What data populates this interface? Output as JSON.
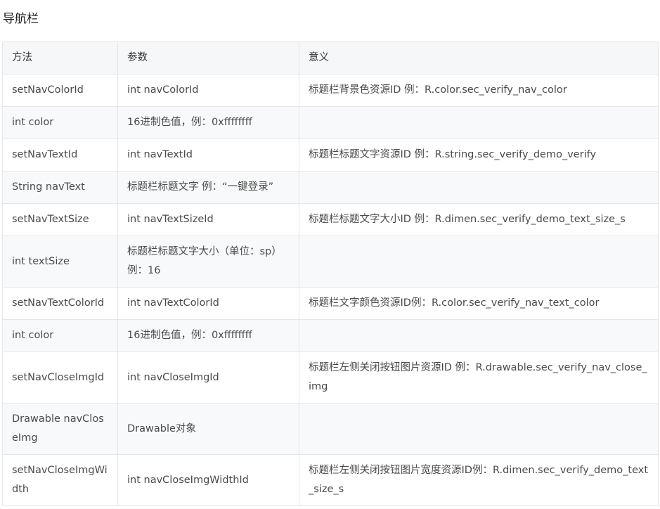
{
  "section": {
    "title": "导航栏"
  },
  "table": {
    "headers": [
      "方法",
      "参数",
      "意义"
    ],
    "rows": [
      {
        "method": "setNavColorId",
        "param": "int navColorId",
        "meaning": "标题栏背景色资源ID 例：R.color.sec_verify_nav_color"
      },
      {
        "method": "int color",
        "param": "16进制色值，例：0xffffffff",
        "meaning": ""
      },
      {
        "method": "setNavTextId",
        "param": "int navTextId",
        "meaning": "标题栏标题文字资源ID 例：R.string.sec_verify_demo_verify"
      },
      {
        "method": "String navText",
        "param": "标题栏标题文字 例：“一键登录”",
        "meaning": ""
      },
      {
        "method": "setNavTextSize",
        "param": "int navTextSizeId",
        "meaning": "标题栏标题文字大小ID 例：R.dimen.sec_verify_demo_text_size_s"
      },
      {
        "method": "int textSize",
        "param": "标题栏标题文字大小（单位：sp）例：16",
        "meaning": ""
      },
      {
        "method": "setNavTextColorId",
        "param": "int navTextColorId",
        "meaning": "标题栏文字颜色资源ID例：R.color.sec_verify_nav_text_color"
      },
      {
        "method": "int color",
        "param": "16进制色值，例：0xffffffff",
        "meaning": ""
      },
      {
        "method": "setNavCloseImgId",
        "param": "int navCloseImgId",
        "meaning": "标题栏左侧关闭按钮图片资源ID 例：R.drawable.sec_verify_nav_close_img"
      },
      {
        "method": "Drawable navCloseImg",
        "param": "Drawable对象",
        "meaning": ""
      },
      {
        "method": "setNavCloseImgWidth",
        "param": "int navCloseImgWidthId",
        "meaning": "标题栏左侧关闭按钮图片宽度资源ID例：R.dimen.sec_verify_demo_text_size_s"
      }
    ]
  }
}
